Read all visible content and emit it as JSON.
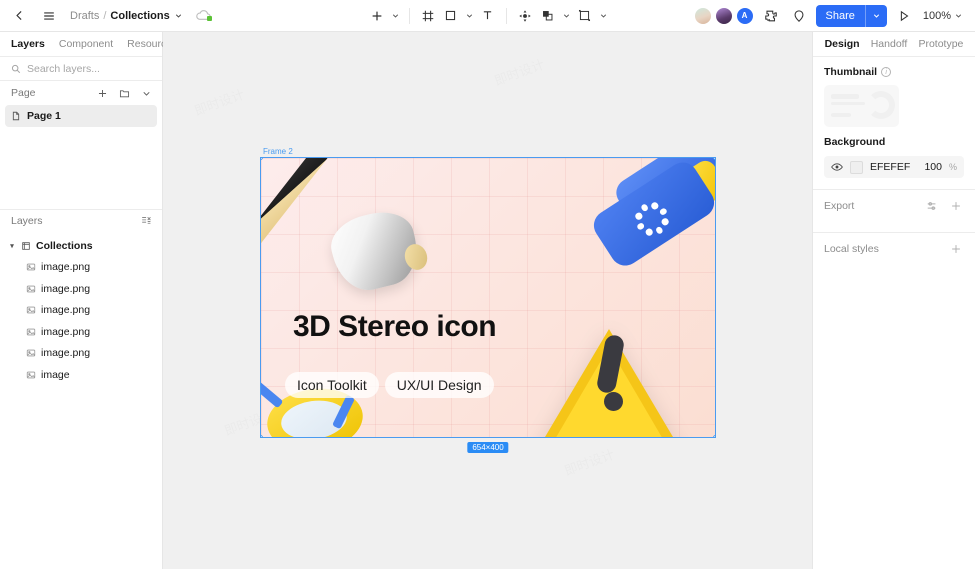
{
  "header": {
    "back_icon": "chevron-left-icon",
    "menu_icon": "hamburger-menu-icon",
    "breadcrumb": {
      "root": "Drafts",
      "separator": "/",
      "current": "Collections"
    },
    "cloud_status_icon": "cloud-sync-icon",
    "tools": [
      {
        "name": "add-tool",
        "icon": "plus-icon",
        "has_dropdown": true
      },
      {
        "name": "frame-tool",
        "icon": "frame-icon",
        "has_dropdown": false
      },
      {
        "name": "shape-tool",
        "icon": "rectangle-icon",
        "has_dropdown": true
      },
      {
        "name": "text-tool",
        "icon": "text-t-icon",
        "has_dropdown": false
      },
      {
        "name": "move-tool",
        "icon": "move-arrows-icon",
        "has_dropdown": false
      },
      {
        "name": "boolean-tool",
        "icon": "boolean-union-icon",
        "has_dropdown": true
      },
      {
        "name": "mask-tool",
        "icon": "mask-icon",
        "has_dropdown": true
      }
    ],
    "avatars": [
      {
        "name": "collaborator-1",
        "initial": ""
      },
      {
        "name": "collaborator-2",
        "initial": ""
      },
      {
        "name": "collaborator-3",
        "initial": "A"
      }
    ],
    "plugin_icon": "plugin-puzzle-icon",
    "comment_icon": "comment-pin-icon",
    "share_label": "Share",
    "present_icon": "play-present-icon",
    "zoom_level": "100%",
    "accent_color": "#2b6cf6"
  },
  "left_panel": {
    "tabs": [
      {
        "label": "Layers",
        "active": true
      },
      {
        "label": "Component",
        "active": false
      },
      {
        "label": "Resource",
        "active": false
      }
    ],
    "search_placeholder": "Search layers...",
    "page_section": {
      "title": "Page",
      "add_icon": "plus-icon",
      "folder_icon": "folder-icon",
      "collapse_icon": "chevron-down-icon"
    },
    "pages": [
      {
        "label": "Page 1",
        "icon": "page-file-icon",
        "selected": true
      }
    ],
    "layers_section": {
      "title": "Layers",
      "filter_icon": "layer-filter-icon"
    },
    "layers": [
      {
        "label": "Collections",
        "icon": "frame-icon",
        "type": "group",
        "expanded": true
      },
      {
        "label": "image.png",
        "icon": "image-icon",
        "type": "child"
      },
      {
        "label": "image.png",
        "icon": "image-icon",
        "type": "child"
      },
      {
        "label": "image.png",
        "icon": "image-icon",
        "type": "child"
      },
      {
        "label": "image.png",
        "icon": "image-icon",
        "type": "child"
      },
      {
        "label": "image.png",
        "icon": "image-icon",
        "type": "child"
      },
      {
        "label": "image",
        "icon": "image-icon",
        "type": "child"
      }
    ]
  },
  "canvas": {
    "frame_label": "Frame 2",
    "size_badge": "654×400",
    "selection_color": "#4a9bf0",
    "artwork": {
      "title": "3D Stereo icon",
      "pills": [
        "Icon Toolkit",
        "UX/UI Design"
      ]
    },
    "watermarks": [
      "即时设计",
      "即时设计",
      "即时设计",
      "即时设计"
    ]
  },
  "right_panel": {
    "tabs": [
      {
        "label": "Design",
        "active": true
      },
      {
        "label": "Handoff",
        "active": false
      },
      {
        "label": "Prototype",
        "active": false
      }
    ],
    "thumbnail": {
      "title": "Thumbnail",
      "info_icon": "info-icon"
    },
    "background": {
      "title": "Background",
      "visibility_icon": "eye-icon",
      "hex": "EFEFEF",
      "opacity": "100",
      "opacity_unit": "%"
    },
    "export": {
      "title": "Export",
      "settings_icon": "sliders-icon",
      "add_icon": "plus-icon"
    },
    "local_styles": {
      "title": "Local styles",
      "add_icon": "plus-icon"
    }
  }
}
